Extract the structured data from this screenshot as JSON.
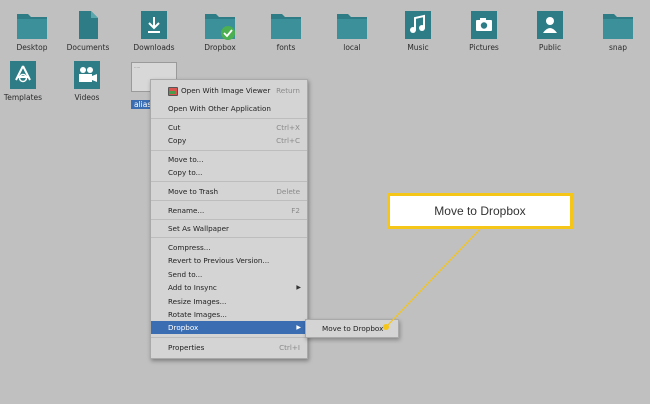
{
  "desktop_icons": [
    {
      "label": "Desktop",
      "type": "folder"
    },
    {
      "label": "Documents",
      "type": "document"
    },
    {
      "label": "Downloads",
      "type": "downloads"
    },
    {
      "label": "Dropbox",
      "type": "dropbox"
    },
    {
      "label": "fonts",
      "type": "folder"
    },
    {
      "label": "local",
      "type": "folder"
    },
    {
      "label": "Music",
      "type": "music"
    },
    {
      "label": "Pictures",
      "type": "pictures"
    },
    {
      "label": "Public",
      "type": "public"
    },
    {
      "label": "snap",
      "type": "folder"
    },
    {
      "label": "Templates",
      "type": "templates"
    },
    {
      "label": "Videos",
      "type": "videos"
    }
  ],
  "selected_file": {
    "label": "alias"
  },
  "context_menu": {
    "items": [
      {
        "label": "Open With Image Viewer",
        "shortcut": "Return"
      },
      {
        "label": "Open With Other Application",
        "shortcut": ""
      },
      {
        "label": "Cut",
        "shortcut": "Ctrl+X"
      },
      {
        "label": "Copy",
        "shortcut": "Ctrl+C"
      },
      {
        "label": "Move to...",
        "shortcut": ""
      },
      {
        "label": "Copy to...",
        "shortcut": ""
      },
      {
        "label": "Move to Trash",
        "shortcut": "Delete"
      },
      {
        "label": "Rename...",
        "shortcut": "F2"
      },
      {
        "label": "Set As Wallpaper",
        "shortcut": ""
      },
      {
        "label": "Compress...",
        "shortcut": ""
      },
      {
        "label": "Revert to Previous Version...",
        "shortcut": ""
      },
      {
        "label": "Send to...",
        "shortcut": ""
      },
      {
        "label": "Add to Insync",
        "shortcut": ""
      },
      {
        "label": "Resize Images...",
        "shortcut": ""
      },
      {
        "label": "Rotate Images...",
        "shortcut": ""
      },
      {
        "label": "Dropbox",
        "shortcut": ""
      },
      {
        "label": "Properties",
        "shortcut": "Ctrl+I"
      }
    ]
  },
  "submenu": {
    "label": "Move to Dropbox"
  },
  "callout": {
    "label": "Move to Dropbox"
  },
  "colors": {
    "desktop_bg": "#c0c0c0",
    "folder_teal": "#2e7d86",
    "selection_blue": "#3b6db3",
    "callout_border": "#f5c518"
  }
}
